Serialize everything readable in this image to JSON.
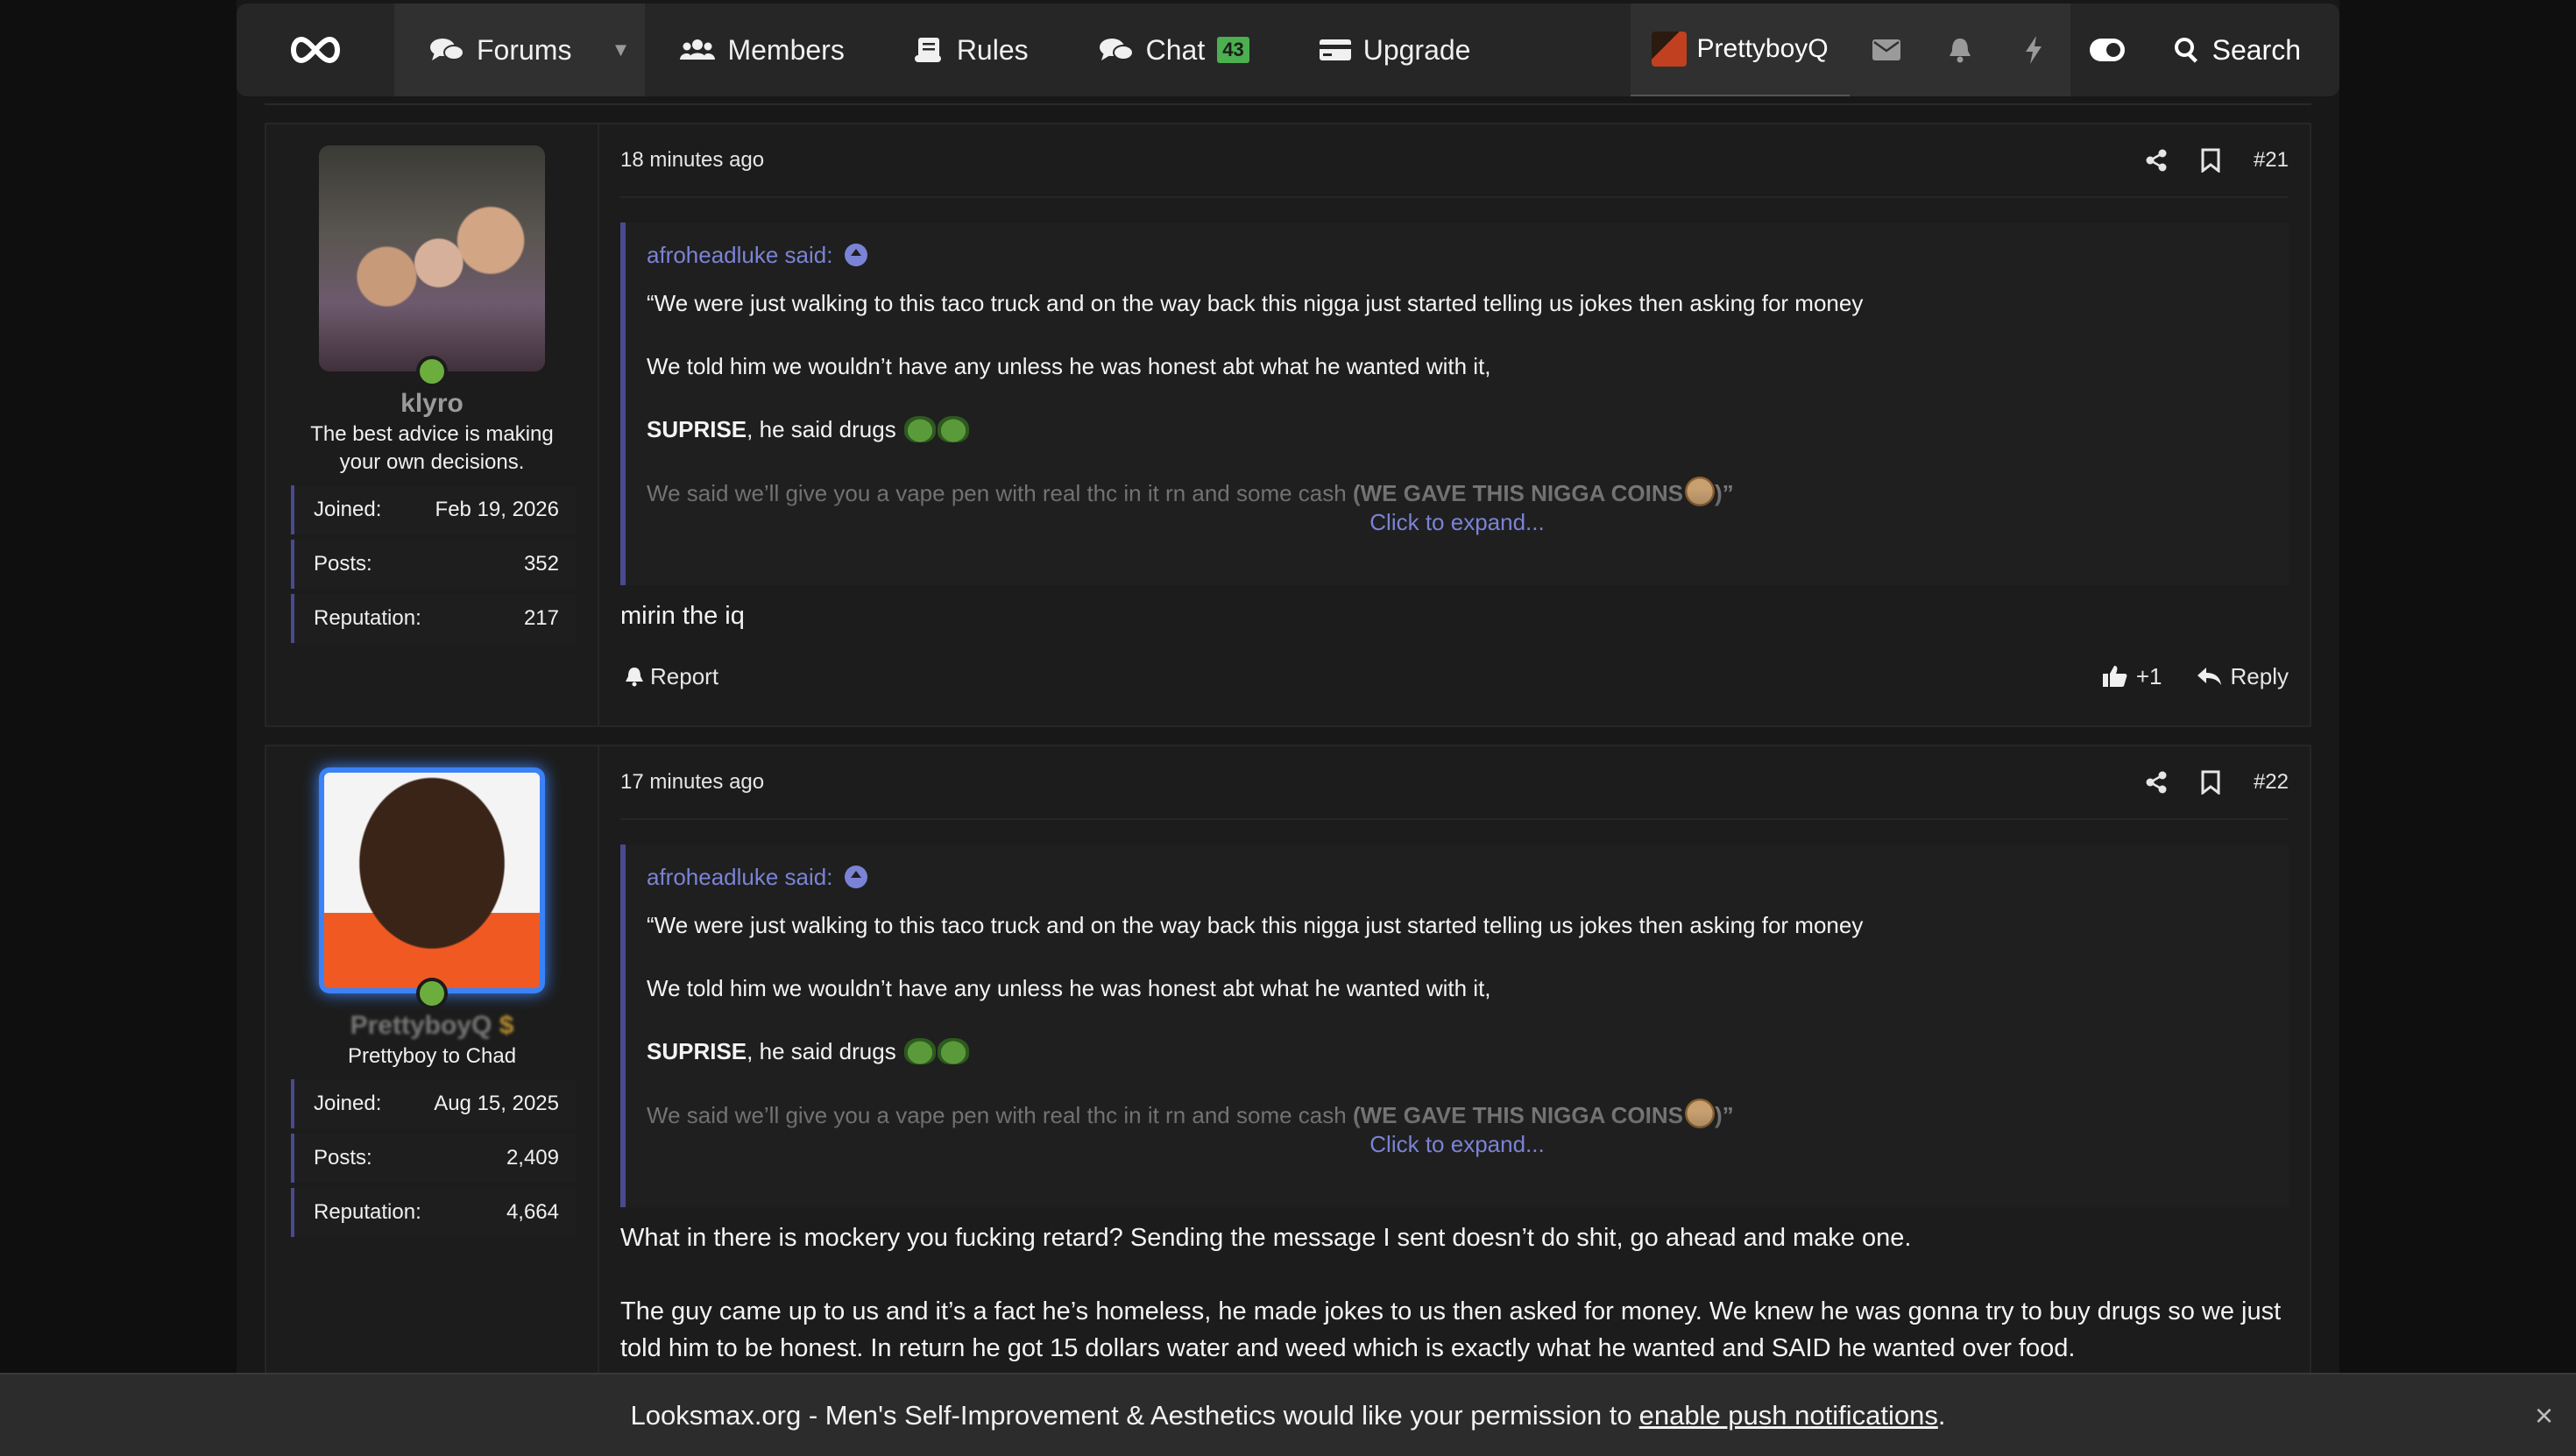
{
  "nav": {
    "forums": "Forums",
    "members": "Members",
    "rules": "Rules",
    "chat": "Chat",
    "chat_count": "43",
    "upgrade": "Upgrade",
    "user": "PrettyboyQ",
    "search": "Search"
  },
  "posts": [
    {
      "time": "18 minutes ago",
      "number": "#21",
      "username": "klyro",
      "user_title": "The best advice is making your own decisions.",
      "stats": [
        {
          "label": "Joined:",
          "value": "Feb 19, 2026"
        },
        {
          "label": "Posts:",
          "value": "352"
        },
        {
          "label": "Reputation:",
          "value": "217"
        }
      ],
      "quote_author": "afroheadluke said:",
      "quote_lines": [
        "“We were just walking to this taco truck and on the way back this nigga just started telling us jokes then asking for money",
        "We told him we wouldn’t have any unless he was honest abt what he wanted with it,"
      ],
      "quote_bold": "SUPRISE",
      "quote_rest": ", he said drugs",
      "quote_last_a": "We said we’ll give you a vape pen with real thc in it rn and some cash ",
      "quote_last_b": "(WE GAVE THIS NIGGA COINS",
      "quote_last_c": ")”",
      "expand": "Click to expand...",
      "text": [
        "mirin the iq"
      ],
      "report": "Report",
      "likes": "+1",
      "reply": "Reply"
    },
    {
      "time": "17 minutes ago",
      "number": "#22",
      "username": "PrettyboyQ",
      "user_title": "Prettyboy to Chad",
      "stats": [
        {
          "label": "Joined:",
          "value": "Aug 15, 2025"
        },
        {
          "label": "Posts:",
          "value": "2,409"
        },
        {
          "label": "Reputation:",
          "value": "4,664"
        }
      ],
      "quote_author": "afroheadluke said:",
      "quote_lines": [
        "“We were just walking to this taco truck and on the way back this nigga just started telling us jokes then asking for money",
        "We told him we wouldn’t have any unless he was honest abt what he wanted with it,"
      ],
      "quote_bold": "SUPRISE",
      "quote_rest": ", he said drugs",
      "quote_last_a": "We said we’ll give you a vape pen with real thc in it rn and some cash ",
      "quote_last_b": "(WE GAVE THIS NIGGA COINS",
      "quote_last_c": ")”",
      "expand": "Click to expand...",
      "text": [
        "What in there is mockery you fucking retard? Sending the message I sent doesn’t do shit, go ahead and make one.",
        "The guy came up to us and it’s a fact he’s homeless, he made jokes to us then asked for money. We knew he was gonna try to buy drugs so we just told him to be honest. In return he got 15 dollars water and weed which is exactly what he wanted and SAID he wanted over food."
      ]
    }
  ],
  "push": {
    "message": "Looksmax.org - Men's Self-Improvement & Aesthetics would like your permission to",
    "link": "enable push notifications",
    "end": ".",
    "close": "×"
  }
}
